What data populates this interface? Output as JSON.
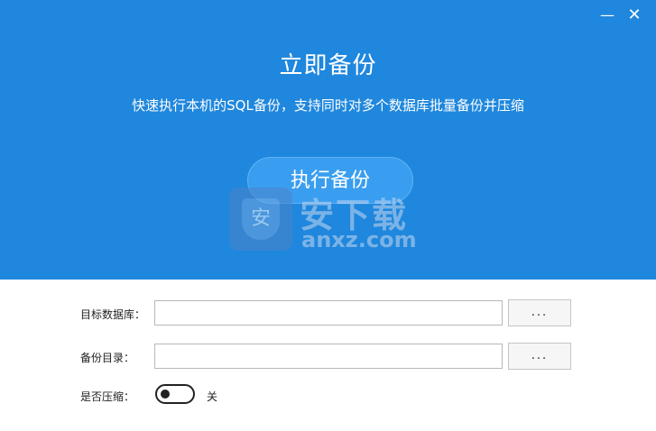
{
  "window": {
    "minimize_glyph": "—",
    "close_glyph": "✕"
  },
  "hero": {
    "title": "立即备份",
    "subtitle": "快速执行本机的SQL备份，支持同时对多个数据库批量备份并压缩",
    "run_button_label": "执行备份"
  },
  "watermark": {
    "shield_char": "安",
    "cn_text": "安下载",
    "en_text": "anxz.com"
  },
  "form": {
    "target_db": {
      "label": "目标数据库：",
      "value": "",
      "browse_label": "..."
    },
    "backup_dir": {
      "label": "备份目录：",
      "value": "",
      "browse_label": "..."
    },
    "compress": {
      "label": "是否压缩：",
      "state_label": "关",
      "enabled": false
    }
  },
  "colors": {
    "hero_bg": "#1f87dd",
    "run_button_bg": "#3a9ef0"
  }
}
